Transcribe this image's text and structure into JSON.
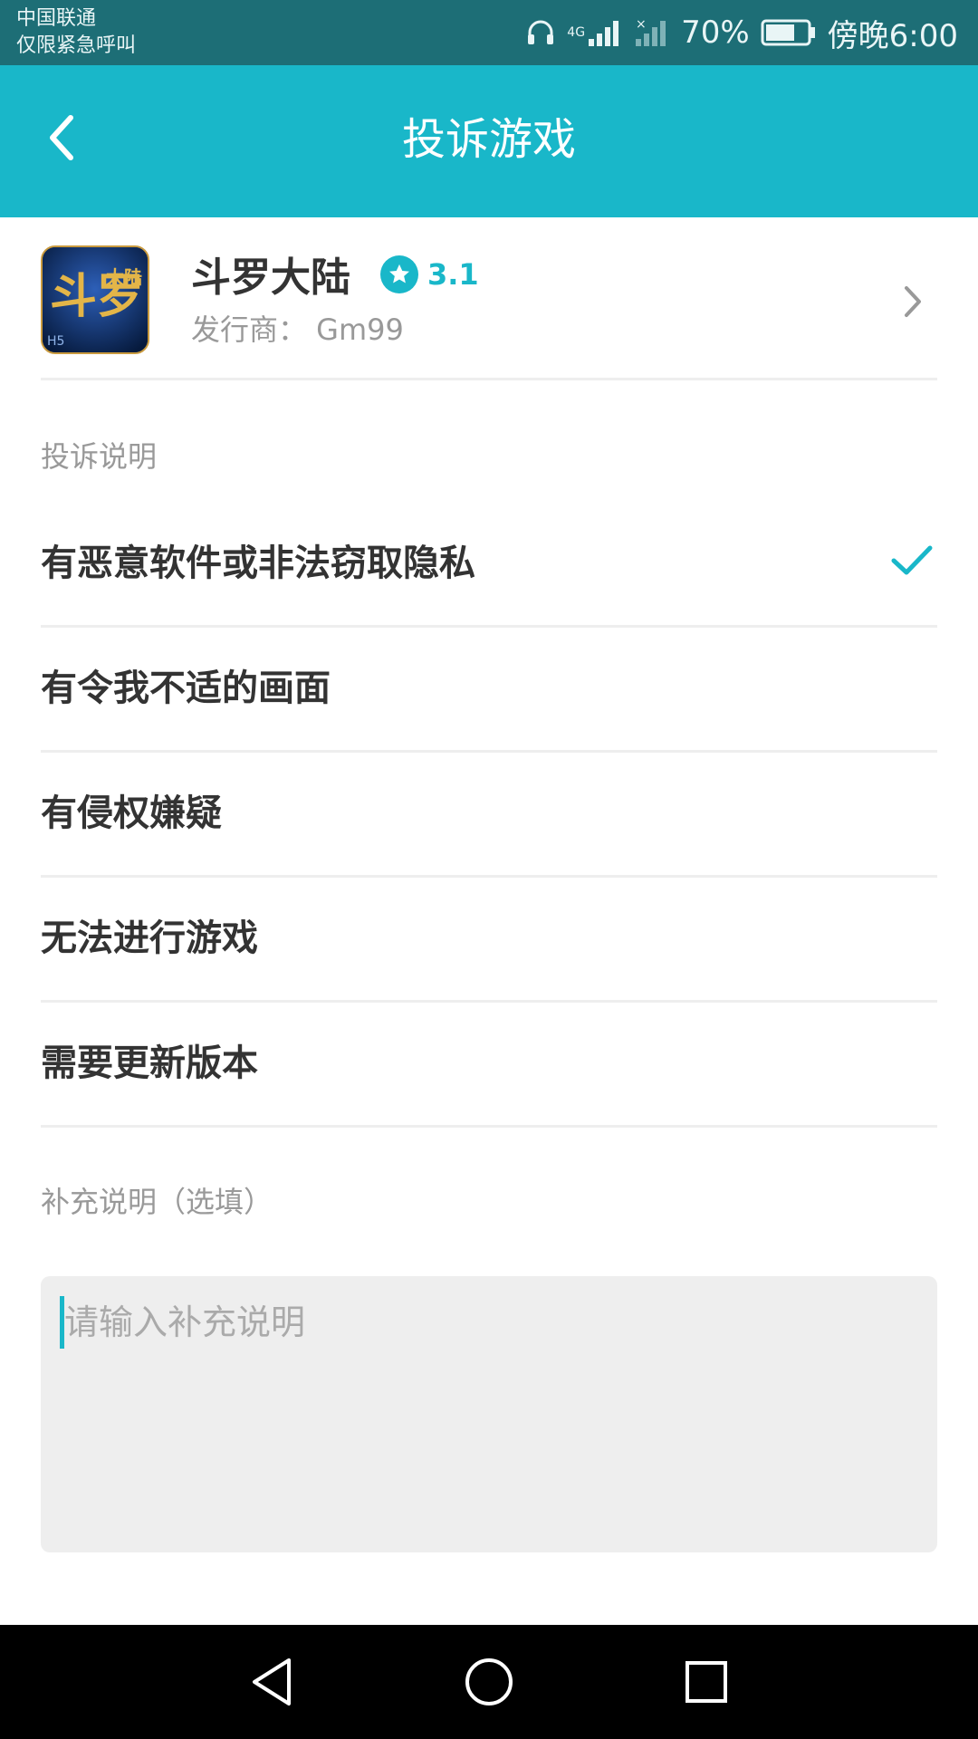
{
  "status_bar": {
    "carrier": "中国联通",
    "emergency": "仅限紧急呼叫",
    "network": "4G",
    "battery": "70%",
    "battery_level": 0.7,
    "time": "傍晚6:00"
  },
  "app_bar": {
    "title": "投诉游戏"
  },
  "game": {
    "name": "斗罗大陆",
    "rating": "3.1",
    "publisher": "发行商： Gm99",
    "icon_text_main": "斗罗",
    "icon_text_corner": "大陆",
    "icon_badge": "H5"
  },
  "complaint": {
    "section_label": "投诉说明",
    "options": [
      {
        "label": "有恶意软件或非法窃取隐私",
        "selected": true
      },
      {
        "label": "有令我不适的画面",
        "selected": false
      },
      {
        "label": "有侵权嫌疑",
        "selected": false
      },
      {
        "label": "无法进行游戏",
        "selected": false
      },
      {
        "label": "需要更新版本",
        "selected": false
      }
    ]
  },
  "supplement": {
    "section_label": "补充说明（选填）",
    "placeholder": "请输入补充说明"
  },
  "colors": {
    "status_bar": "#1d6e76",
    "accent": "#19b7c9",
    "divider": "#eeeeee"
  }
}
